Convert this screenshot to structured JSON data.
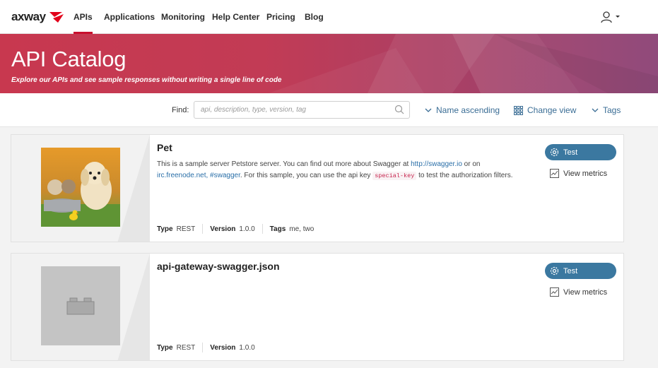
{
  "nav": {
    "logo": "axway",
    "items": [
      {
        "label": "APIs",
        "active": true
      },
      {
        "label": "Applications"
      },
      {
        "label": "Monitoring"
      },
      {
        "label": "Help Center"
      },
      {
        "label": "Pricing"
      },
      {
        "label": "Blog"
      }
    ],
    "user_icon": "user-icon"
  },
  "banner": {
    "title": "API Catalog",
    "subtitle": "Explore our APIs and see sample responses without writing a single line of code"
  },
  "filters": {
    "find_label": "Find:",
    "search_placeholder": "api, description, type, version, tag",
    "sort_label": "Name ascending",
    "view_label": "Change view",
    "tags_label": "Tags"
  },
  "apis": [
    {
      "title": "Pet",
      "desc_parts": {
        "p1": "This is a sample server Petstore server. You can find out more about Swagger at ",
        "link1": "http://swagger.io",
        "p2": " or on ",
        "link2": "irc.freenode.net, #swagger",
        "p3": ". For this sample, you can use the api key ",
        "code": "special-key",
        "p4": " to test the authorization filters."
      },
      "type_key": "Type",
      "type": "REST",
      "version_key": "Version",
      "version": "1.0.0",
      "tags_key": "Tags",
      "tags": "me, two",
      "test_label": "Test",
      "metrics_label": "View metrics"
    },
    {
      "title": "api-gateway-swagger.json",
      "type_key": "Type",
      "type": "REST",
      "version_key": "Version",
      "version": "1.0.0",
      "test_label": "Test",
      "metrics_label": "View metrics"
    }
  ],
  "colors": {
    "accent": "#c8102e",
    "button": "#3b78a0",
    "link": "#3a6d95"
  }
}
